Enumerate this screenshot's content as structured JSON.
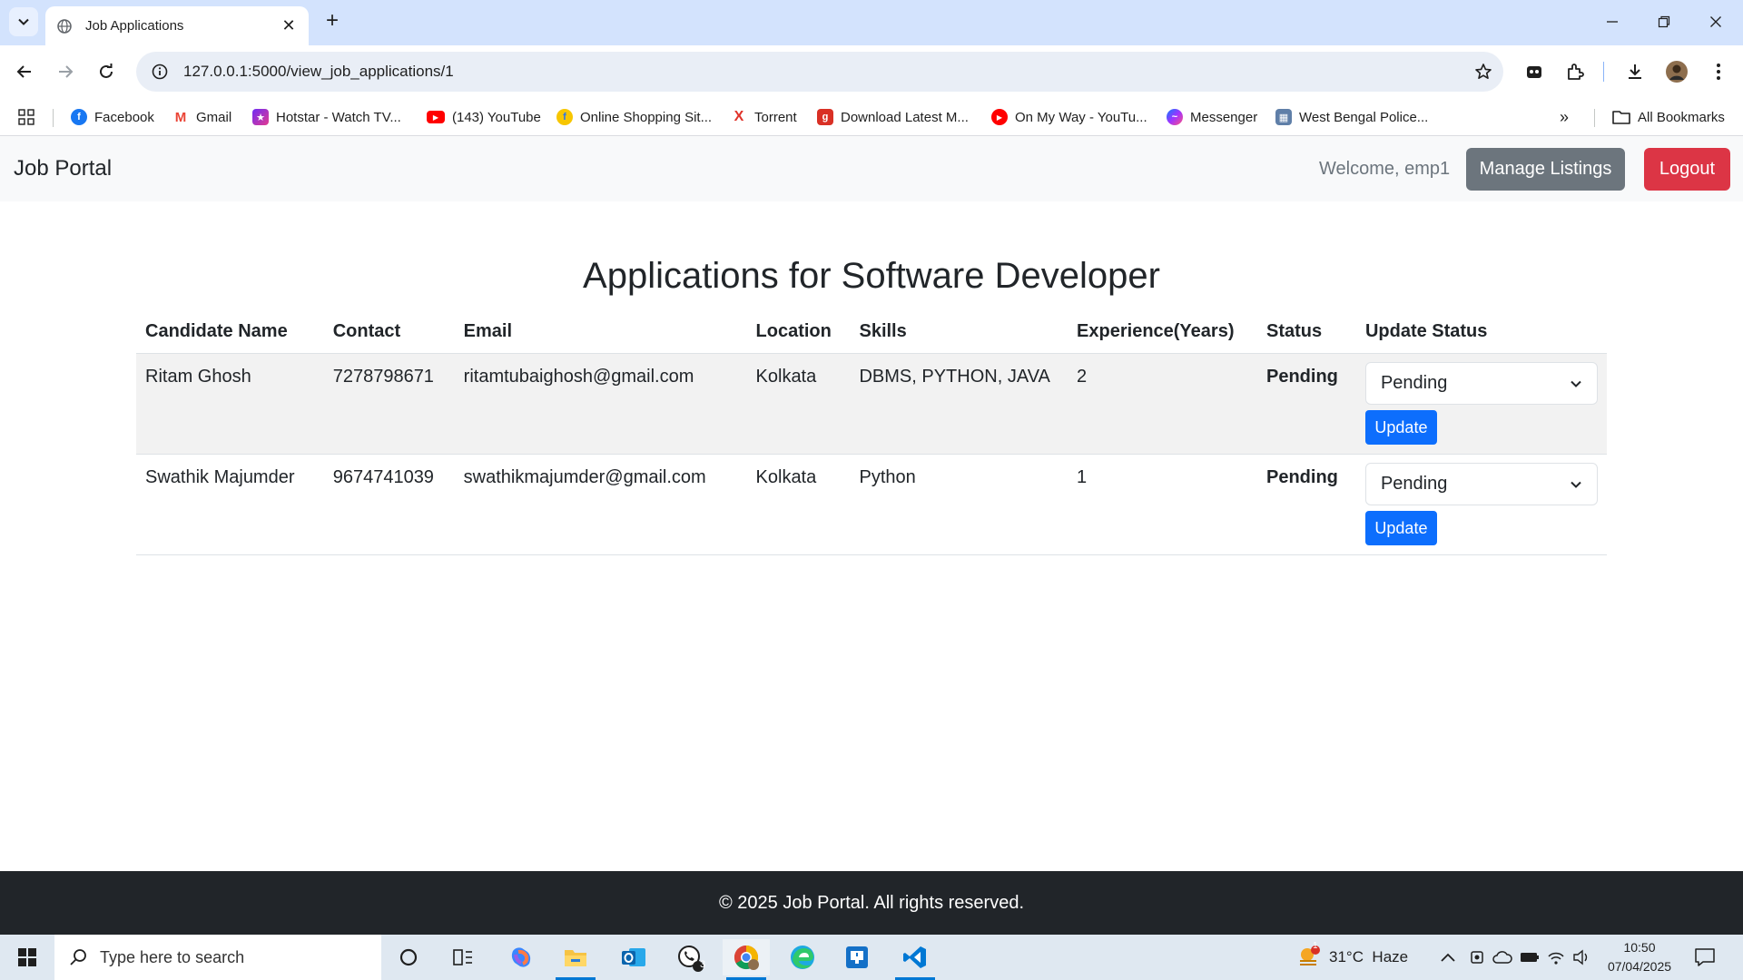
{
  "browser": {
    "tab_title": "Job Applications",
    "url": "127.0.0.1:5000/view_job_applications/1",
    "bookmarks": [
      {
        "label": "Facebook",
        "icon": "facebook-icon",
        "color": "#1877f2"
      },
      {
        "label": "Gmail",
        "icon": "gmail-icon",
        "color": "#ea4335"
      },
      {
        "label": "Hotstar - Watch TV...",
        "icon": "hotstar-icon",
        "color": "#6f2cf5"
      },
      {
        "label": "(143) YouTube",
        "icon": "youtube-icon",
        "color": "#ff0000"
      },
      {
        "label": "Online Shopping Sit...",
        "icon": "flipkart-icon",
        "color": "#f7c600"
      },
      {
        "label": "Torrent",
        "icon": "torrent-icon",
        "color": "#e0332a"
      },
      {
        "label": "Download Latest M...",
        "icon": "download-site-icon",
        "color": "#d93025"
      },
      {
        "label": "On My Way - YouTu...",
        "icon": "youtube-icon",
        "color": "#ff0000"
      },
      {
        "label": "Messenger",
        "icon": "messenger-icon",
        "color": "#a033ff"
      },
      {
        "label": "West Bengal Police...",
        "icon": "police-icon",
        "color": "#5f7fa8"
      }
    ],
    "all_bookmarks": "All Bookmarks"
  },
  "navbar": {
    "brand": "Job Portal",
    "welcome": "Welcome, emp1",
    "manage_label": "Manage Listings",
    "logout_label": "Logout"
  },
  "page": {
    "heading": "Applications for Software Developer"
  },
  "table": {
    "headers": [
      "Candidate Name",
      "Contact",
      "Email",
      "Location",
      "Skills",
      "Experience(Years)",
      "Status",
      "Update Status"
    ],
    "rows": [
      {
        "name": "Ritam Ghosh",
        "contact": "7278798671",
        "email": "ritamtubaighosh@gmail.com",
        "location": "Kolkata",
        "skills": "DBMS, PYTHON, JAVA",
        "experience": "2",
        "status": "Pending",
        "select_value": "Pending",
        "update_label": "Update"
      },
      {
        "name": "Swathik Majumder",
        "contact": "9674741039",
        "email": "swathikmajumder@gmail.com",
        "location": "Kolkata",
        "skills": "Python",
        "experience": "1",
        "status": "Pending",
        "select_value": "Pending",
        "update_label": "Update"
      }
    ]
  },
  "footer": {
    "text": "© 2025 Job Portal. All rights reserved."
  },
  "taskbar": {
    "search_placeholder": "Type here to search",
    "weather": "31°C  Haze",
    "weather_badge": "1",
    "whatsapp_badge": "3",
    "time": "10:50",
    "date": "07/04/2025"
  }
}
